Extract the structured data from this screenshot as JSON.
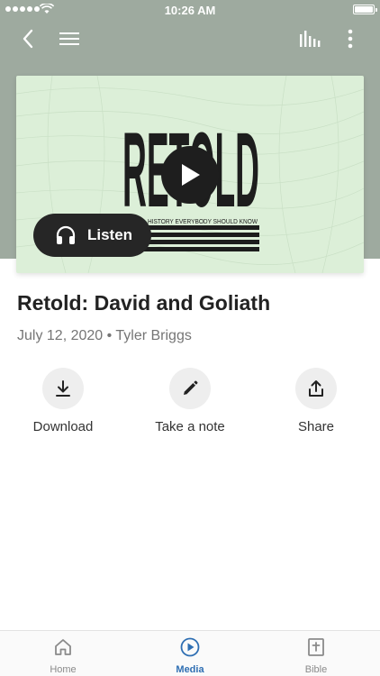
{
  "status_bar": {
    "time": "10:26 AM"
  },
  "artwork": {
    "title_text": "RETOLD",
    "tagline": "HISTORY EVERYBODY SHOULD KNOW"
  },
  "player": {
    "listen_label": "Listen"
  },
  "content": {
    "title": "Retold: David and Goliath",
    "meta": "July 12, 2020 • Tyler Briggs"
  },
  "actions": [
    {
      "label": "Download",
      "icon": "download-icon"
    },
    {
      "label": "Take a note",
      "icon": "pencil-icon"
    },
    {
      "label": "Share",
      "icon": "share-icon"
    }
  ],
  "tabs": [
    {
      "label": "Home",
      "icon": "home-icon"
    },
    {
      "label": "Media",
      "icon": "play-circle-icon",
      "active": true
    },
    {
      "label": "Bible",
      "icon": "bible-icon"
    }
  ],
  "colors": {
    "header": "#9eaa9f",
    "artwork_bg": "#dcefd8",
    "accent": "#2f6fb3",
    "dark_button": "#262626"
  }
}
